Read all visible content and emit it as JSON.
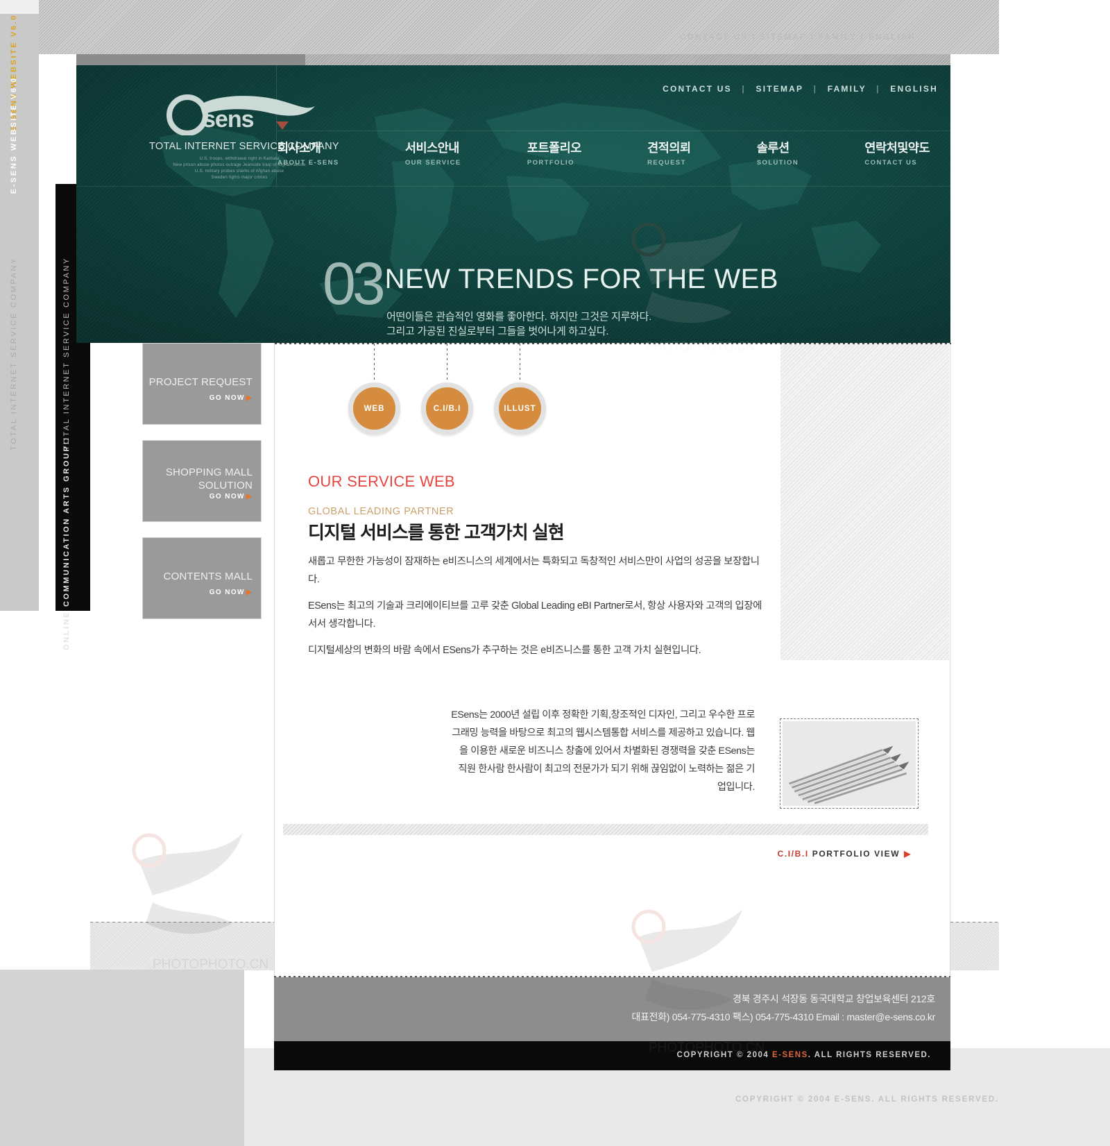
{
  "background": {
    "ribbon_gold": "E-SENS WEBSITE  V6.0",
    "ribbon_white": "E-SENS WEBSITE  V6.0",
    "ribbon_gray": "TOTAL INTERNET SERVICE COMPANY",
    "ribbon_black_1": "ONLINE COMMUNICATION ARTS GROUP!!",
    "ribbon_black_2": "TOTAL INTERNET SERVICE COMPANY",
    "faint_topnav": "CONTACT US   |   SITEMAP   |   FAMILY   |   ENGLISH",
    "faint_copyright": "COPYRIGHT © 2004 E-SENS. ALL RIGHTS RESERVED."
  },
  "header": {
    "logo_text": "esens",
    "logo_tagline": "TOTAL INTERNET SERVICE COMPANY",
    "logo_fineprint": "U.S. troops, withdrawal right in Karbala\nNew prison abuse photos outrage Jeanside Iraqi of Afghan abuse\nU.S. military probes claims of Afghan abuse\nSweden fights major crimes",
    "topnav": [
      {
        "label": "CONTACT US"
      },
      {
        "label": "SITEMAP"
      },
      {
        "label": "FAMILY"
      },
      {
        "label": "ENGLISH"
      }
    ],
    "topnav_separator": "|",
    "mainnav": [
      {
        "kr": "회사소개",
        "en": "ABOUT E-SENS"
      },
      {
        "kr": "서비스안내",
        "en": "OUR SERVICE"
      },
      {
        "kr": "포트폴리오",
        "en": "PORTFOLIO"
      },
      {
        "kr": "견적의뢰",
        "en": "REQUEST"
      },
      {
        "kr": "솔루션",
        "en": "SOLUTION"
      },
      {
        "kr": "연락처및약도",
        "en": "CONTACT US"
      }
    ],
    "claim_number": "03",
    "claim_title": "NEW TRENDS FOR THE WEB",
    "claim_sub_line1": "어떤이들은 관습적인 영화를 좋아한다. 하지만 그것은 지루하다.",
    "claim_sub_line2": "그리고 가공된 진실로부터 그들을 벗어나게 하고싶다."
  },
  "left_promos": [
    {
      "title": "PROJECT REQUEST",
      "go": "GO NOW"
    },
    {
      "title": "SHOPPING MALL\nSOLUTION",
      "go": "GO NOW"
    },
    {
      "title": "CONTENTS MALL",
      "go": "GO NOW"
    }
  ],
  "board": {
    "tabs": [
      {
        "label": "WEB"
      },
      {
        "label": "C.I/B.I"
      },
      {
        "label": "ILLUST"
      }
    ],
    "heading_red": "OUR SERVICE WEB",
    "heading_gold": "GLOBAL LEADING PARTNER",
    "heading_kr": "디지털 서비스를 통한 고객가치 실현",
    "body_p1": "새롭고 무한한 가능성이 잠재하는 e비즈니스의 세계에서는 특화되고 독창적인 서비스만이 사업의 성공을 보장합니다.",
    "body_p2": "ESens는 최고의 기술과 크리에이티브를 고루 갖춘 Global Leading eBI Partner로서, 항상 사용자와 고객의 입장에 서서 생각합니다.",
    "body_p3": "디지털세상의 변화의 바람 속에서 ESens가 추구하는 것은 e비즈니스를 통한 고객 가치 실현입니다.",
    "right_copy": "ESens는 2000년 설립 이후 정확한 기획,창조적인 디자인, 그리고 우수한 프로그래밍 능력을 바탕으로 최고의 웹시스템통합 서비스를 제공하고 있습니다.\n웹을 이용한 새로운 비즈니스 창출에 있어서 차별화된 경쟁력을 갖춘 ESens는 직원 한사람 한사람이 최고의 전문가가 되기 위해 끊임없이 노력하는 젊은 기업입니다.",
    "portfolio_link_label": "C.I/B.I",
    "portfolio_link_text": " PORTFOLIO VIEW",
    "portfolio_link_arrow": "▶"
  },
  "footer": {
    "address": "경북 경주시 석장동 동국대학교 창업보육센터 212호",
    "contact": "대표전화) 054-775-4310  팩스) 054-775-4310   Email : master@e-sens.co.kr",
    "copyright_prefix": "COPYRIGHT © 2004 ",
    "copyright_brand": "E-SENS",
    "copyright_suffix": ". ALL RIGHTS RESERVED."
  },
  "colors": {
    "teal": "#0e3e3a",
    "orange": "#d68c3f",
    "red": "#e8443f",
    "gold": "#c8a06a",
    "gray": "#8d8d8d"
  }
}
